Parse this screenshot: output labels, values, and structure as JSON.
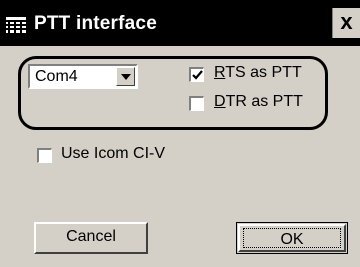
{
  "window": {
    "title": "PTT interface",
    "close_label": "x"
  },
  "port": {
    "selected": "Com4"
  },
  "checkboxes": {
    "rts": {
      "label_accel": "R",
      "label_rest": "TS as PTT",
      "checked": true
    },
    "dtr": {
      "label_accel": "D",
      "label_rest": "TR as PTT",
      "checked": false
    },
    "icom": {
      "label": "Use Icom CI-V",
      "checked": false
    }
  },
  "buttons": {
    "cancel": "Cancel",
    "ok": "OK"
  }
}
